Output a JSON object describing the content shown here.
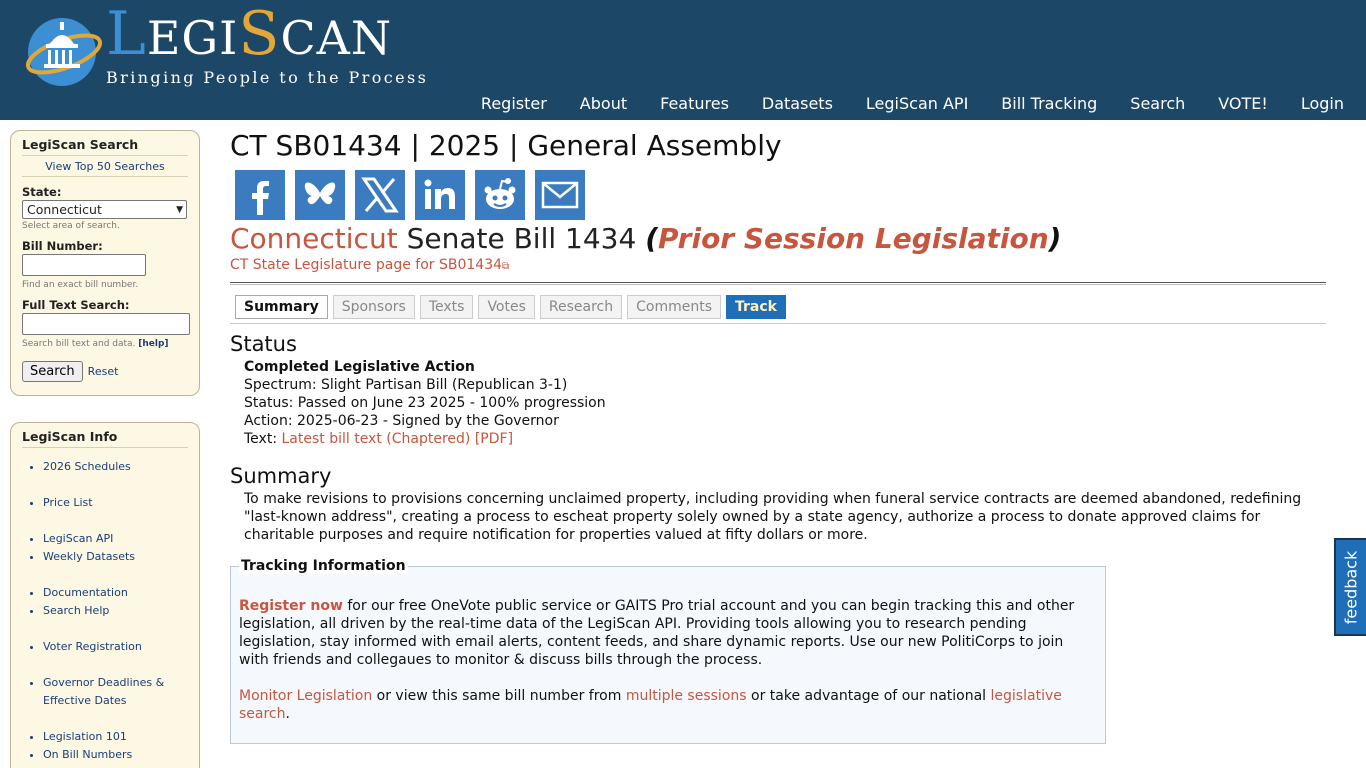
{
  "header": {
    "logo_text": "LegiScan",
    "logo_parts": [
      "L",
      "EGI",
      "S",
      "CAN"
    ],
    "tagline": "Bringing People to the Process",
    "nav": [
      "Register",
      "About",
      "Features",
      "Datasets",
      "LegiScan API",
      "Bill Tracking",
      "Search",
      "VOTE!",
      "Login"
    ]
  },
  "search_box": {
    "title": "LegiScan Search",
    "top50": "View Top 50 Searches",
    "state_label": "State:",
    "state_value": "Connecticut",
    "state_hint": "Select area of search.",
    "bill_label": "Bill Number:",
    "bill_value": "",
    "bill_hint": "Find an exact bill number.",
    "fulltext_label": "Full Text Search:",
    "fulltext_value": "",
    "fulltext_hint": "Search bill text and data.",
    "help": "[help]",
    "search_button": "Search",
    "reset": "Reset"
  },
  "info_box": {
    "title": "LegiScan Info",
    "items": [
      "2026 Schedules",
      "Price List",
      "LegiScan API",
      "Weekly Datasets",
      "Documentation",
      "Search Help",
      "Voter Registration",
      "Governor Deadlines & Effective Dates",
      "Legislation 101",
      "On Bill Numbers"
    ]
  },
  "main": {
    "page_title": "CT SB01434 | 2025 | General Assembly",
    "share_icons": [
      "facebook-icon",
      "bluesky-icon",
      "x-icon",
      "linkedin-icon",
      "reddit-icon",
      "email-icon"
    ],
    "state": "Connecticut",
    "bill_name": "Senate Bill 1434",
    "prior": "Prior Session Legislation",
    "state_link": "CT State Legislature page for SB01434",
    "tabs": [
      "Summary",
      "Sponsors",
      "Texts",
      "Votes",
      "Research",
      "Comments",
      "Track"
    ],
    "status_heading": "Status",
    "status": {
      "heading": "Completed Legislative Action",
      "spectrum": "Spectrum: Slight Partisan Bill (Republican 3-1)",
      "status": "Status: Passed on June 23 2025 - 100% progression",
      "action": "Action: 2025-06-23 - Signed by the Governor",
      "text_label": "Text: ",
      "text_link": "Latest bill text (Chaptered) [PDF]"
    },
    "summary_heading": "Summary",
    "summary": "To make revisions to provisions concerning unclaimed property, including providing when funeral service contracts are deemed abandoned, redefining \"last-known address\", creating a process to escheat property solely owned by a state agency, authorize a process to donate approved claims for charitable purposes and require notification for properties valued at fifty dollars or more.",
    "tracking": {
      "legend": "Tracking Information",
      "register": "Register now",
      "para1_rest": " for our free OneVote public service or GAITS Pro trial account and you can begin tracking this and other legislation, all driven by the real-time data of the LegiScan API. Providing tools allowing you to research pending legislation, stay informed with email alerts, content feeds, and share dynamic reports. Use our new PolitiCorps to join with friends and collegaues to monitor & discuss bills through the process.",
      "monitor": "Monitor Legislation",
      "mid1": " or view this same bill number from ",
      "multiple": "multiple sessions",
      "mid2": " or take advantage of our national ",
      "legsearch": "legislative search",
      "end": "."
    }
  },
  "feedback": "feedback",
  "colors": {
    "header_bg": "#1d4766",
    "accent_red": "#c8553d",
    "share_blue": "#3b7bbf",
    "track_blue": "#1e6fb8"
  }
}
